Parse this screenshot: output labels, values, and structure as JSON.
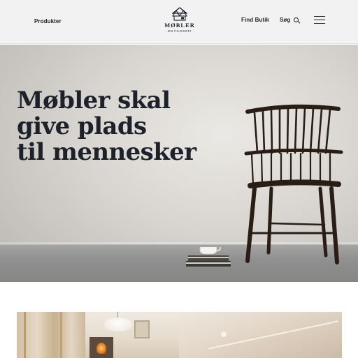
{
  "header": {
    "products_label": "Produkter",
    "logo_name": "MØBLER",
    "logo_tagline": "· EN FILOSOFI ·",
    "find_store_label": "Find Butik",
    "search_label": "Søg"
  },
  "hero": {
    "title_lines": [
      "Møbler skal",
      "give plads",
      "til mennesker"
    ]
  },
  "icons": {
    "logo": "house-logo-icon",
    "search": "search-icon",
    "menu": "hamburger-menu-icon"
  },
  "colors": {
    "text": "#1d2129",
    "header_bg": "#f2f2f2"
  }
}
